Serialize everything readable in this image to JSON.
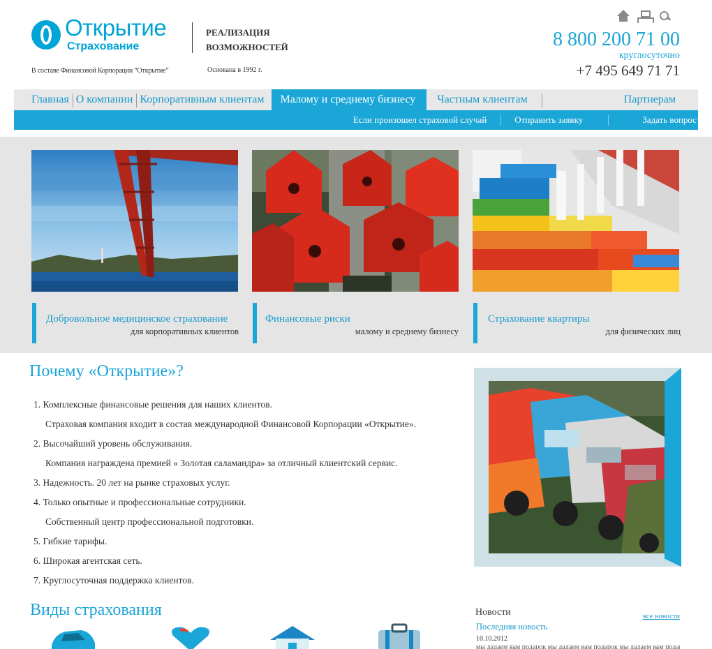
{
  "header": {
    "brand_name": "Открытие",
    "brand_sub": "Страхование",
    "slogan": "РЕАЛИЗАЦИЯ ВОЗМОЖНОСТЕЙ",
    "corp_note": "В составе Финансовой Корпорации “Открытие”",
    "founded": "Основана в 1992 г.",
    "phone_main": "8 800 200 71 00",
    "phone_note": "круглосуточно",
    "phone_alt": "+7 495 649 71 71",
    "util_icons": [
      "home-icon",
      "sitemap-icon",
      "search-icon"
    ]
  },
  "nav": {
    "main": [
      {
        "label": "Главная"
      },
      {
        "label": "О компании"
      },
      {
        "label": "Корпоративным клиентам"
      },
      {
        "label": "Малому и среднему бизнесу",
        "active": true
      },
      {
        "label": "Частным клиентам"
      },
      {
        "label": "Партнерам"
      }
    ],
    "sub": [
      {
        "label": "Если произошел страховой случай"
      },
      {
        "label": "Отправить заявку"
      },
      {
        "label": "Задать вопрос"
      }
    ]
  },
  "tiles": [
    {
      "title": "Добровольное медицинское страхование",
      "subtitle": "для корпоративных клиентов"
    },
    {
      "title": "Финансовые риски",
      "subtitle": "малому и среднему бизнесу"
    },
    {
      "title": "Страхование квартиры",
      "subtitle": "для физических лиц"
    }
  ],
  "why": {
    "title": "Почему «Открытие»?",
    "items": [
      {
        "text": "1.  Комплексные финансовые решения для наших клиентов."
      },
      {
        "text": "Страховая компания входит в состав международной Финансовой Корпорации «Открытие».",
        "indent": true
      },
      {
        "text": "2. Высочайший уровень обслуживания."
      },
      {
        "text": "Компания награждена премией « Золотая саламандра» за  отличный клиентский сервис.",
        "indent": true
      },
      {
        "text": "3.  Надежность. 20 лет на рынке страховых услуг."
      },
      {
        "text": "4. Только опытные и профессиональные сотрудники."
      },
      {
        "text": "Собственный центр профессиональной подготовки.",
        "indent": true
      },
      {
        "text": "5.  Гибкие тарифы."
      },
      {
        "text": "6. Широкая агентская сеть."
      },
      {
        "text": "7. Круглосуточная поддержка клиентов."
      }
    ]
  },
  "types": {
    "title": "Виды страхования",
    "icons": [
      "car-icon",
      "heart-icon",
      "house-icon",
      "luggage-icon"
    ]
  },
  "news": {
    "heading": "Новости",
    "all_link": "все новости",
    "latest_link": "Последняя новость",
    "date": "10.10.2012",
    "excerpt": "мы дадаем вам подарок мы дадаем вам подарок мы дадаем вам подарок"
  },
  "colors": {
    "accent": "#1aa6d6",
    "nav_bg": "#e8e8e8",
    "band_bg": "#e5e5e5"
  }
}
